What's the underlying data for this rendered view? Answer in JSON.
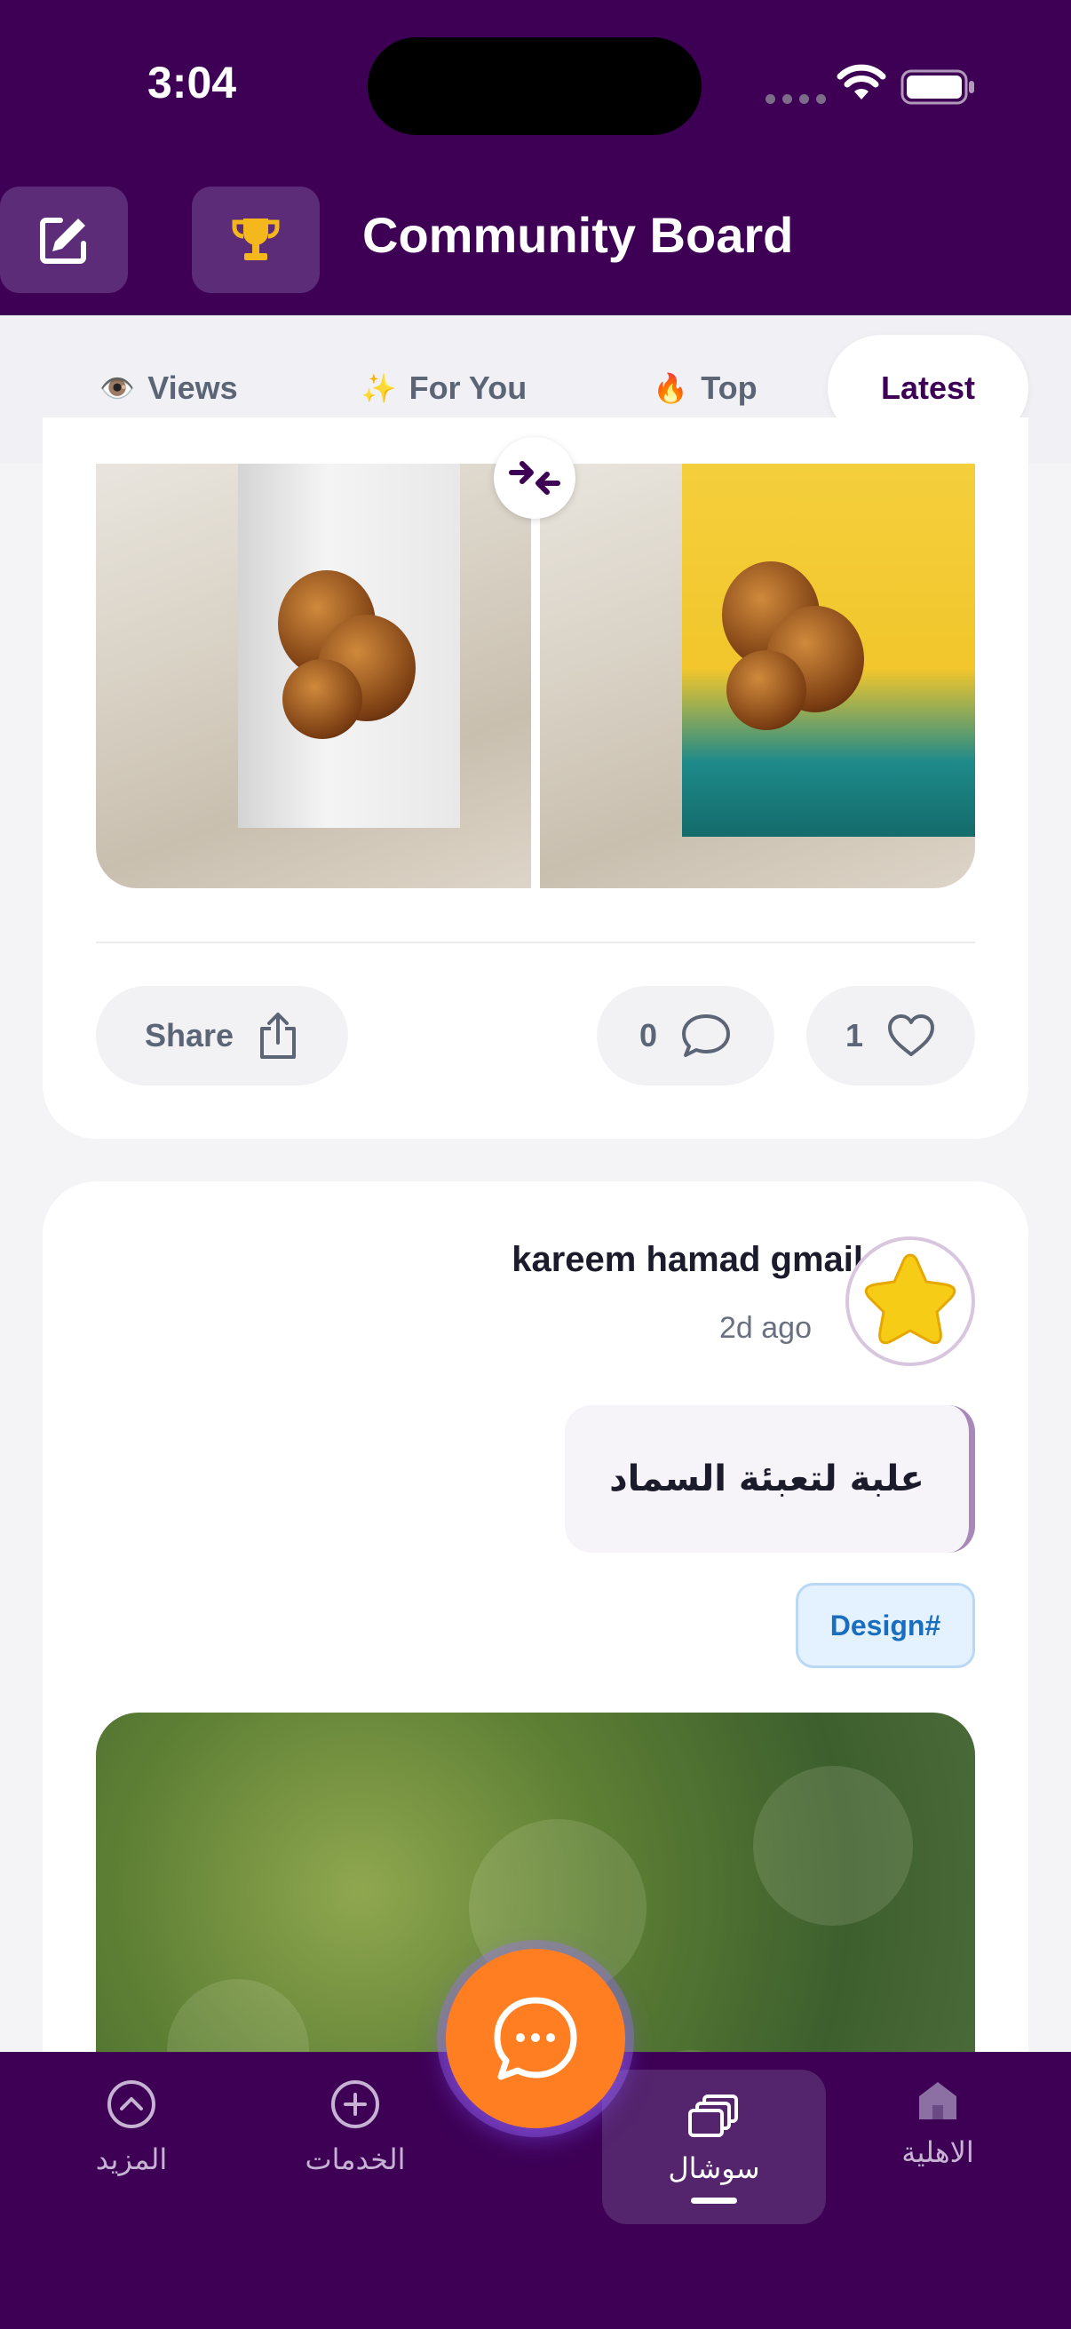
{
  "status_bar": {
    "time": "3:04"
  },
  "header": {
    "title": "Community Board",
    "edit_icon": "edit-icon",
    "trophy_icon": "trophy-icon"
  },
  "tabs": [
    {
      "emoji": "👁️",
      "label": "Views"
    },
    {
      "emoji": "✨",
      "label": "For You"
    },
    {
      "emoji": "🔥",
      "label": "Top"
    },
    {
      "emoji": "",
      "label": "Latest",
      "active": true
    }
  ],
  "post1": {
    "share_label": "Share",
    "comments_count": "0",
    "likes_count": "1"
  },
  "post2": {
    "author": "kareem hamad gmail",
    "time": "2d ago",
    "body": "علبة لتعبئة السماد",
    "tag": "Design#"
  },
  "bottom_nav": [
    {
      "label": "المزيد",
      "icon": "chevron-up-circle-icon"
    },
    {
      "label": "الخدمات",
      "icon": "plus-circle-icon"
    },
    {
      "label": "سوشال",
      "icon": "social-cards-icon",
      "active": true
    },
    {
      "label": "الاهلية",
      "icon": "home-icon"
    }
  ],
  "colors": {
    "brand_purple": "#3d0055",
    "fab_orange": "#ff7e21",
    "tag_blue": "#1a6ec0"
  }
}
